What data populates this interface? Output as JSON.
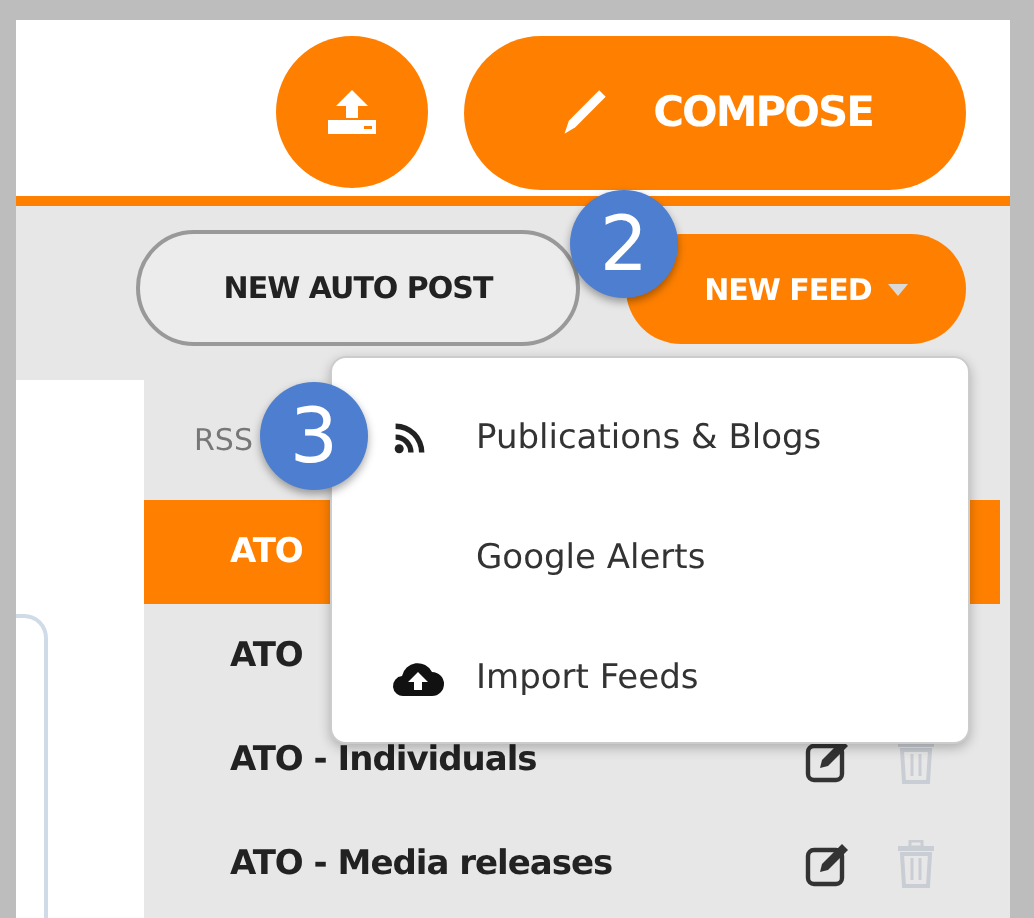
{
  "header": {
    "compose_button": "COMPOSE"
  },
  "toolbar": {
    "auto_post_button": "NEW AUTO POST",
    "new_feed_button": "NEW FEED"
  },
  "feed_list": {
    "label": "RSS",
    "feeds": [
      {
        "title": "ATO",
        "selected": true
      },
      {
        "title": "ATO",
        "selected": false
      },
      {
        "title": "ATO - Individuals",
        "selected": false
      },
      {
        "title": "ATO - Media releases",
        "selected": false
      }
    ]
  },
  "dropdown": {
    "items": [
      {
        "label": "Publications & Blogs"
      },
      {
        "label": "Google Alerts"
      },
      {
        "label": "Import Feeds"
      }
    ]
  },
  "callouts": [
    "2",
    "3"
  ]
}
